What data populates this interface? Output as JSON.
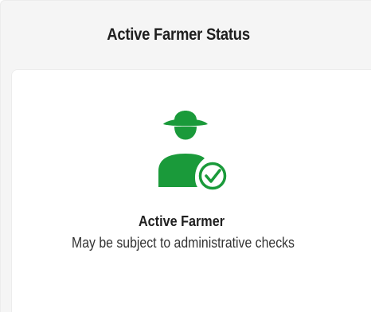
{
  "panel": {
    "title": "Active Farmer Status"
  },
  "status": {
    "icon": "farmer-verified-icon",
    "title": "Active Farmer",
    "subtitle": "May be subject to administrative checks",
    "color": "#1a9a3a"
  }
}
